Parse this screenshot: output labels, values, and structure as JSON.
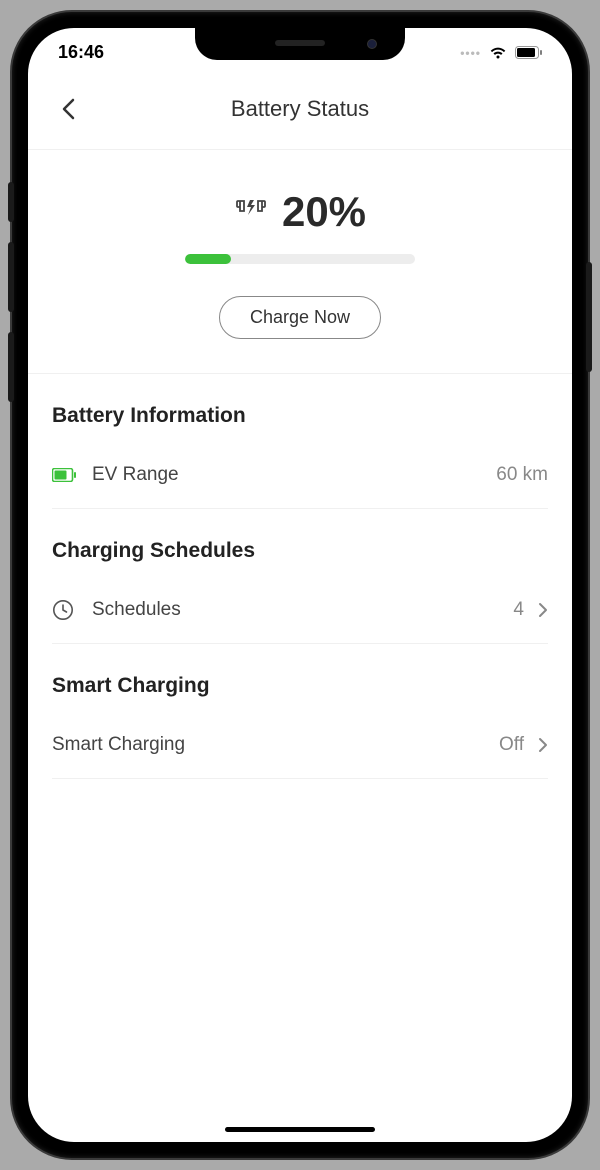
{
  "status_bar": {
    "time": "16:46"
  },
  "header": {
    "title": "Battery Status"
  },
  "hero": {
    "percent_label": "20%",
    "percent_value": 20,
    "charge_button": "Charge Now"
  },
  "sections": {
    "battery_info": {
      "title": "Battery Information",
      "ev_range": {
        "label": "EV Range",
        "value": "60 km"
      }
    },
    "charging_schedules": {
      "title": "Charging Schedules",
      "schedules": {
        "label": "Schedules",
        "value": "4"
      }
    },
    "smart_charging": {
      "title": "Smart Charging",
      "row": {
        "label": "Smart Charging",
        "value": "Off"
      }
    }
  },
  "colors": {
    "accent_green": "#3cc13b",
    "text_muted": "#888888"
  }
}
